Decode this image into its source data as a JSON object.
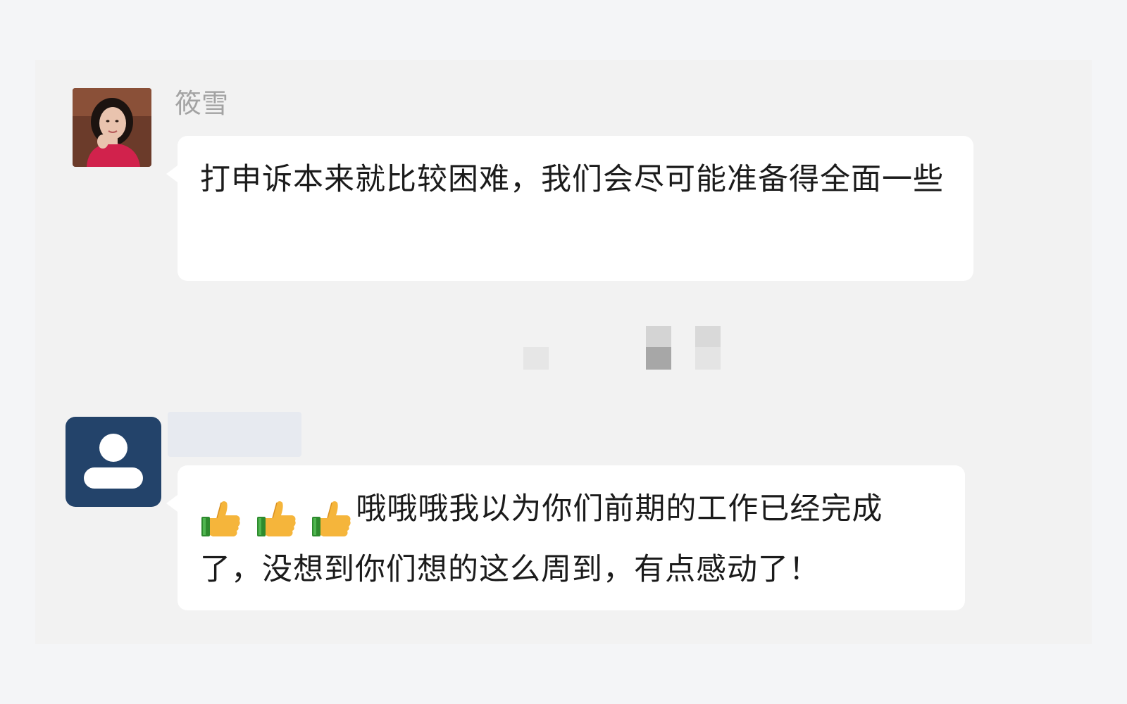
{
  "messages": [
    {
      "sender": "筱雪",
      "text": "打申诉本来就比较困难，我们会尽可能准备得全面一些"
    },
    {
      "sender": "",
      "emoji": [
        "thumbs-up",
        "thumbs-up",
        "thumbs-up"
      ],
      "text": "哦哦哦我以为你们前期的工作已经完成了，没想到你们想的这么周到，有点感动了！"
    }
  ],
  "colors": {
    "page_background": "#f4f5f7",
    "chat_background": "#f2f2f2",
    "bubble": "#ffffff",
    "sender_name": "#a3a3a3",
    "default_avatar": "#23436a"
  }
}
